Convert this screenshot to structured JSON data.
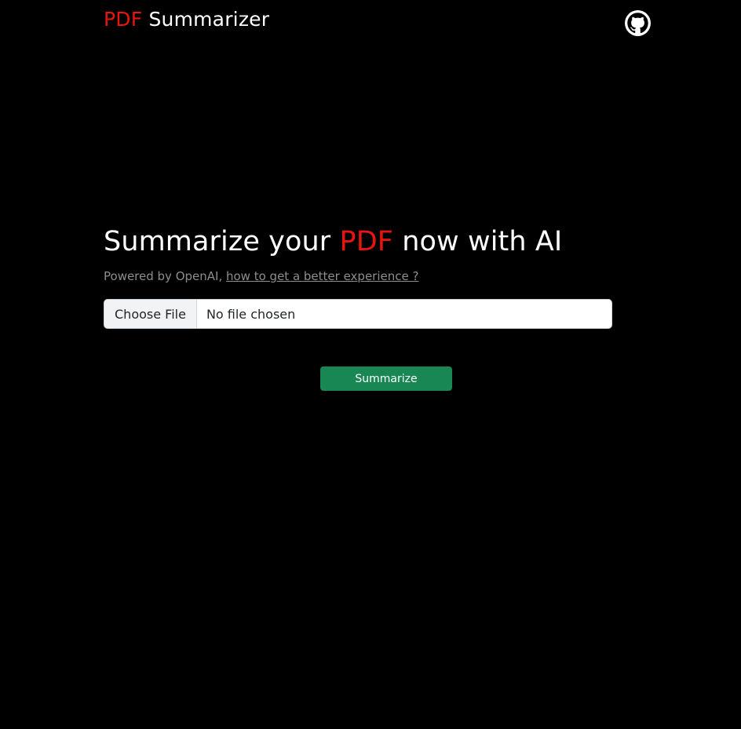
{
  "header": {
    "brand_accent": "PDF",
    "brand_rest": " Summarizer",
    "github_icon": "github-icon"
  },
  "hero": {
    "title_before": "Summarize your ",
    "title_accent": "PDF",
    "title_after": " now with AI",
    "subtitle_text": "Powered by OpenAI, ",
    "subtitle_link": "how to get a better experience ?"
  },
  "upload": {
    "choose_label": "Choose File",
    "status_text": "No file chosen"
  },
  "actions": {
    "summarize_label": "Summarize"
  },
  "colors": {
    "background": "#000000",
    "accent_red": "#e8140f",
    "button_green": "#198754",
    "muted_text": "#8d8d8d"
  }
}
